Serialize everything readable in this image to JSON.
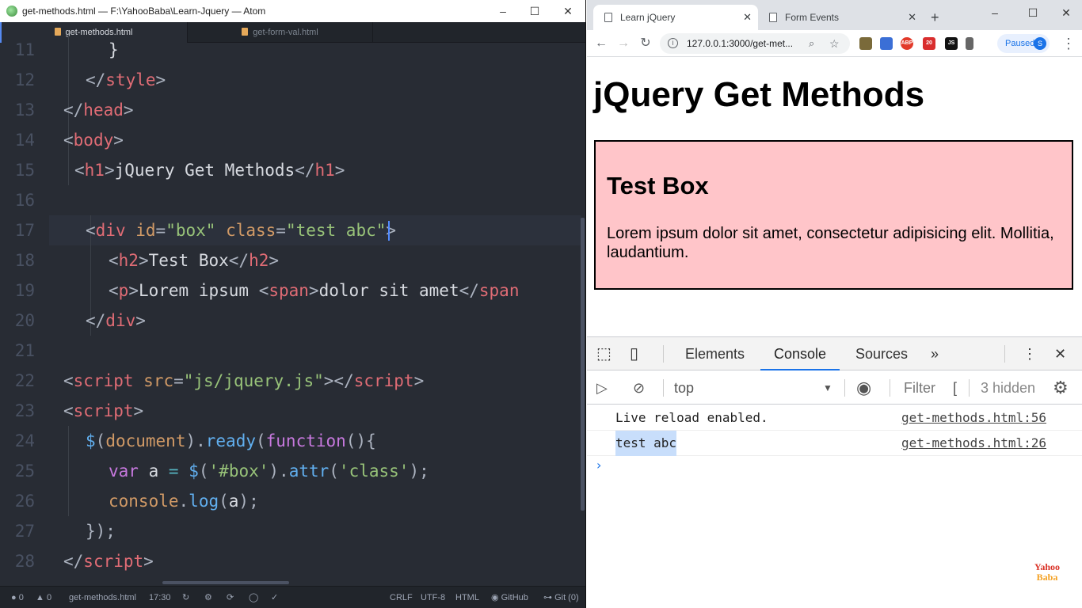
{
  "atom": {
    "title": "get-methods.html — F:\\YahooBaba\\Learn-Jquery — Atom",
    "tabs": [
      {
        "label": "get-methods.html",
        "active": true
      },
      {
        "label": "get-form-val.html",
        "active": false
      }
    ],
    "line_numbers": [
      "11",
      "12",
      "13",
      "14",
      "15",
      "16",
      "17",
      "18",
      "19",
      "20",
      "21",
      "22",
      "23",
      "24",
      "25",
      "26",
      "27",
      "28"
    ],
    "code": {
      "l11": "}",
      "l15_text": "jQuery Get Methods",
      "l17_id": "\"box\"",
      "l17_class": "\"test abc\"",
      "l18_text": "Test Box",
      "l19_text1": "Lorem ipsum ",
      "l19_text2": "dolor sit amet",
      "l22_src": "\"js/jquery.js\"",
      "l25_sel": "'#box'",
      "l25_arg": "'class'"
    },
    "status": {
      "errors": "0",
      "warnings": "0",
      "file": "get-methods.html",
      "cursor": "17:30",
      "eol": "CRLF",
      "encoding": "UTF-8",
      "grammar": "HTML",
      "github": "GitHub",
      "git": "Git (0)"
    }
  },
  "browser": {
    "tabs": [
      {
        "label": "Learn jQuery",
        "active": true
      },
      {
        "label": "Form Events",
        "active": false
      }
    ],
    "url": "127.0.0.1:3000/get-met...",
    "profile_status": "Paused",
    "profile_initial": "S",
    "page": {
      "heading": "jQuery Get Methods",
      "box_title": "Test Box",
      "box_text": "Lorem ipsum dolor sit amet, consectetur adipisicing elit. Mollitia, laudantium."
    },
    "devtools": {
      "tabs": [
        "Elements",
        "Console",
        "Sources"
      ],
      "active_tab": "Console",
      "context": "top",
      "filter_placeholder": "Filter",
      "hidden_count": "3 hidden",
      "messages": [
        {
          "text": "Live reload enabled.",
          "source": "get-methods.html:56"
        },
        {
          "text": "test abc",
          "source": "get-methods.html:26"
        }
      ]
    },
    "watermark": {
      "line1": "Yahoo",
      "line2": "Baba"
    }
  },
  "colors": {
    "editor_bg": "#282c34",
    "box_bg": "#ffc5c9",
    "accent": "#1a73e8"
  }
}
